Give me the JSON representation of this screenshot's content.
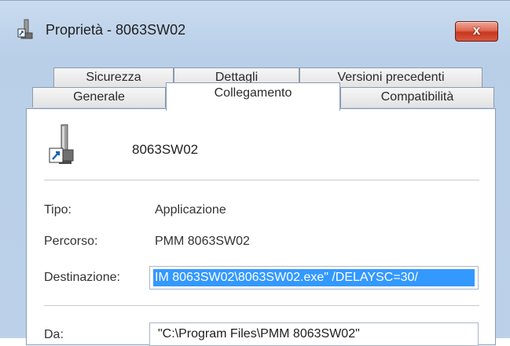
{
  "window": {
    "title": "Proprietà - 8063SW02",
    "close_label": "x"
  },
  "tabs": {
    "row1": [
      "Sicurezza",
      "Dettagli",
      "Versioni precedenti"
    ],
    "row2": [
      "Generale",
      "Collegamento",
      "Compatibilità"
    ],
    "active": "Collegamento"
  },
  "panel": {
    "name": "8063SW02",
    "tipo_label": "Tipo:",
    "tipo_value": "Applicazione",
    "percorso_label": "Percorso:",
    "percorso_value": "PMM 8063SW02",
    "destinazione_label": "Destinazione:",
    "destinazione_value": "IM 8063SW02\\8063SW02.exe\" /DELAYSC=30/",
    "da_label": "Da:",
    "da_value": "\"C:\\Program Files\\PMM 8063SW02\""
  },
  "colors": {
    "selection": "#3399ff",
    "close_button": "#d24a32"
  }
}
